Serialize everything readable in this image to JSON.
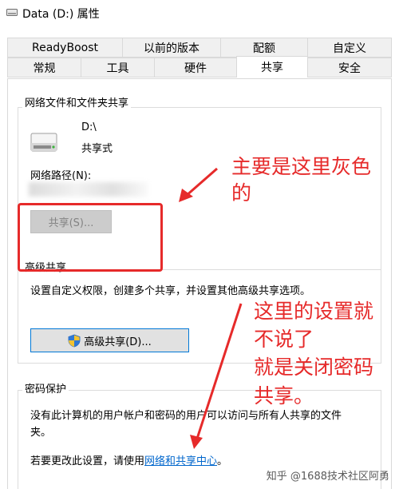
{
  "window": {
    "title": "Data (D:) 属性"
  },
  "tabs_row1": [
    "ReadyBoost",
    "以前的版本",
    "配额",
    "自定义"
  ],
  "tabs_row2": [
    "常规",
    "工具",
    "硬件",
    "共享",
    "安全"
  ],
  "active_tab": "共享",
  "network_sharing": {
    "group_title": "网络文件和文件夹共享",
    "drive_name": "D:\\",
    "share_status": "共享式",
    "network_path_label": "网络路径(N):",
    "share_button": "共享(S)..."
  },
  "advanced_sharing": {
    "group_title": "高级共享",
    "description": "设置自定义权限，创建多个共享，并设置其他高级共享选项。",
    "button": "高级共享(D)..."
  },
  "password_protection": {
    "group_title": "密码保护",
    "description_line1": "没有此计算机的用户帐户和密码的用户可以访问与所有人共享的文件",
    "description_line2": "夹。",
    "change_prefix": "若要更改此设置，请使用",
    "link_text": "网络和共享中心",
    "change_suffix": "。"
  },
  "annotations": {
    "note1_line1": "主要是这里灰色",
    "note1_line2": "的",
    "note2_line1": "这里的设置就",
    "note2_line2": "不说了",
    "note2_line3": "就是关闭密码",
    "note2_line4": "共享。"
  },
  "watermark": "知乎 @1688技术社区阿勇",
  "colors": {
    "annotation_red": "#e62a2a",
    "link_blue": "#0066cc",
    "focus_blue": "#0078d7"
  }
}
